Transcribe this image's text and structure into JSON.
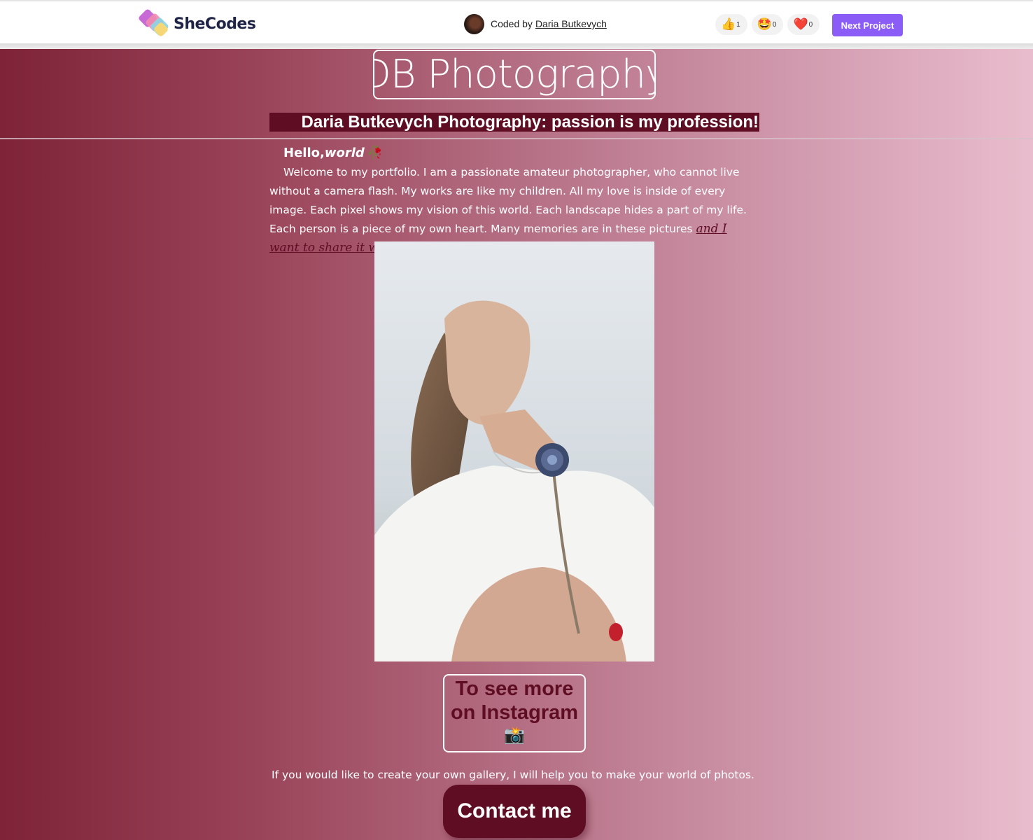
{
  "header": {
    "logo_text": "SheCodes",
    "coded_by_prefix": "Coded by",
    "author_name": "Daria Butkevych",
    "reactions": [
      {
        "icon": "thumbs-up-icon",
        "emoji": "👍",
        "count": "1"
      },
      {
        "icon": "star-struck-icon",
        "emoji": "🤩",
        "count": "0"
      },
      {
        "icon": "heart-icon",
        "emoji": "❤️",
        "count": "0"
      }
    ],
    "next_project_label": "Next Project"
  },
  "page": {
    "title": "DB Photography",
    "subtitle": "Daria Butkevych Photography: passion is my profession!",
    "hello": "Hello,",
    "world": "world",
    "rose_emoji": "🥀",
    "intro_text": "Welcome to my portfolio. I am a passionate amateur photographer, who cannot live without a camera flash. My works are like my children. All my love is inside of every image. Each pixel shows my vision of this world. Each landscape hides a part of my life. Each person is a piece of my own heart. Many memories are in these pictures ",
    "share_link": "and I want to share it with you!",
    "instagram_label": "To see more on Instagram",
    "instagram_emoji": "📸",
    "help_text": "If you would like to create your own gallery, I will help you to make your world of photos.",
    "contact_label": "Contact me"
  },
  "colors": {
    "accent": "#8b5cf6",
    "dark_burgundy": "#5e0d22",
    "gradient_start": "#7e2338",
    "gradient_end": "#e9bdcd"
  }
}
